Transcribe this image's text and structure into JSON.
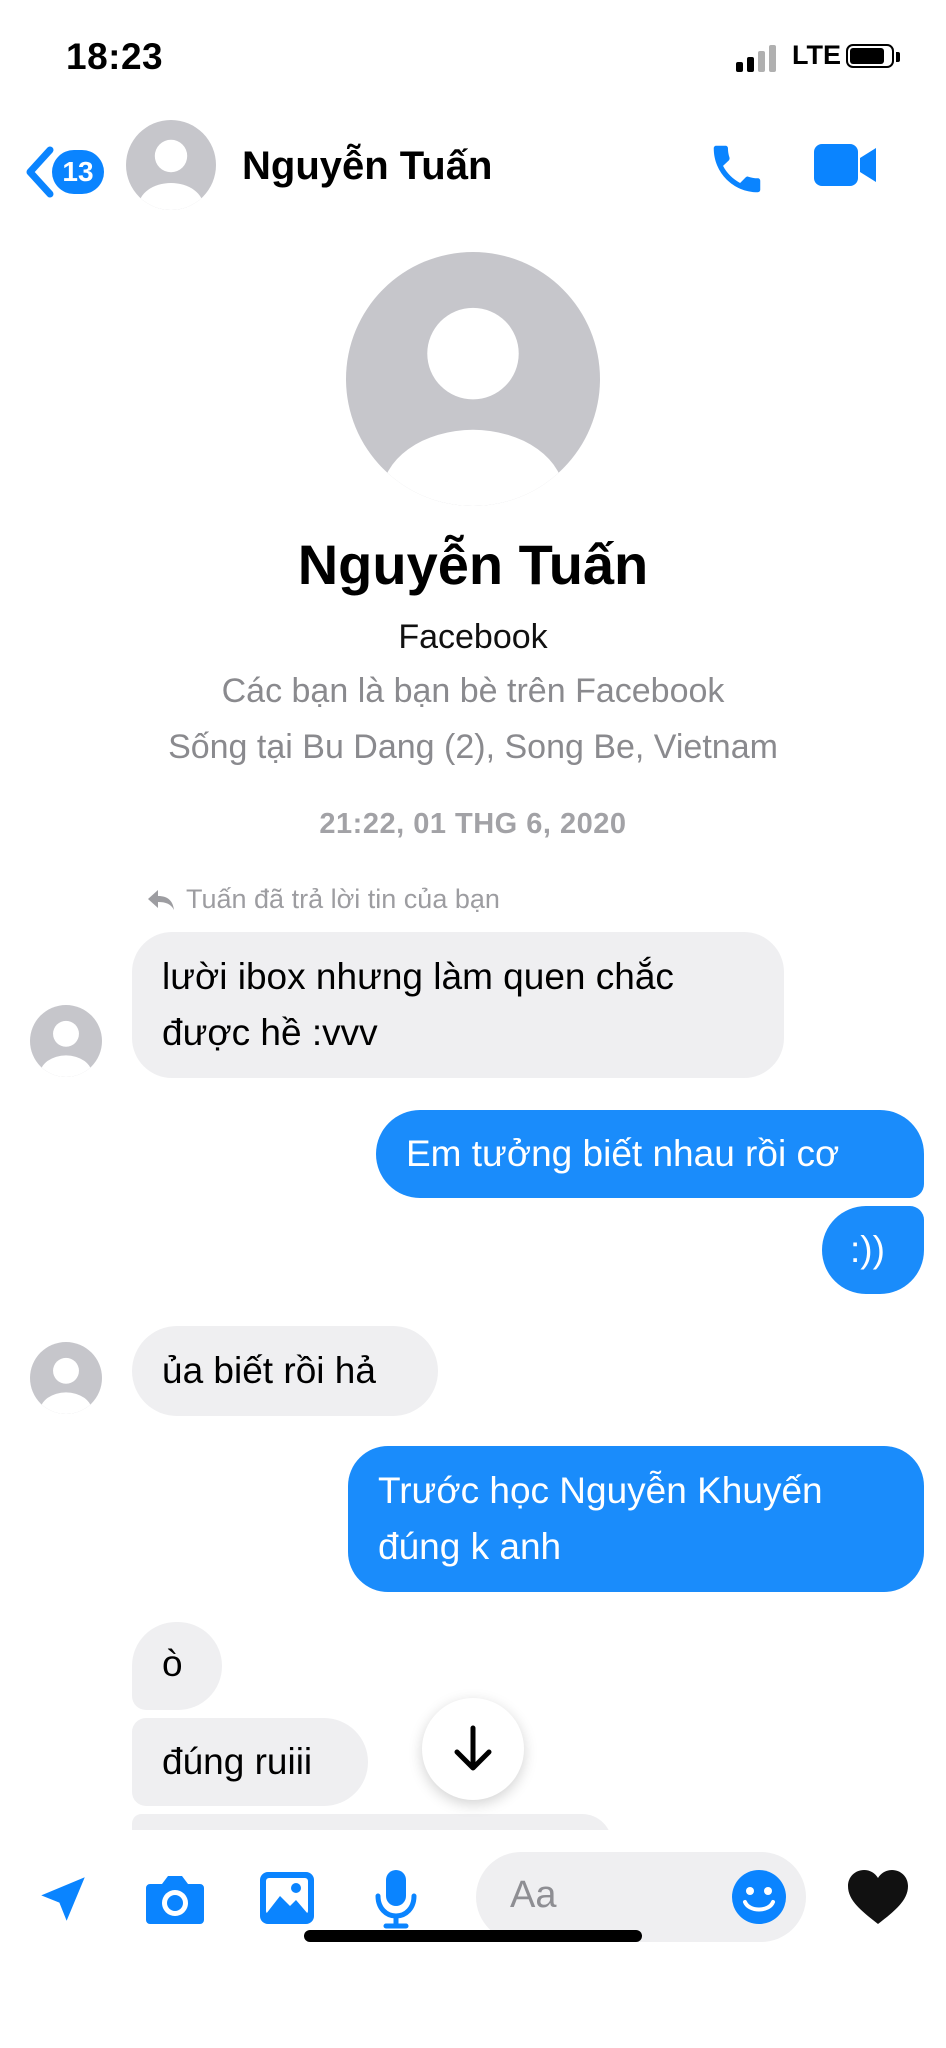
{
  "status_bar": {
    "time": "18:23",
    "network": "LTE"
  },
  "header": {
    "unread_count": "13",
    "contact_name": "Nguyễn Tuấn"
  },
  "profile": {
    "name": "Nguyễn Tuấn",
    "source": "Facebook",
    "relation": "Các bạn là bạn bè trên Facebook",
    "location": "Sống tại Bu Dang (2), Song Be, Vietnam"
  },
  "thread": {
    "timestamp": "21:22, 01 THG 6, 2020",
    "reply_note": "Tuấn đã trả lời tin của bạn",
    "messages": [
      {
        "sender": "them",
        "lines": [
          "lười ibox nhưng làm quen chắc",
          "được hề :vvv"
        ]
      },
      {
        "sender": "me",
        "lines": [
          "Em tưởng biết nhau rồi cơ"
        ]
      },
      {
        "sender": "me",
        "lines": [
          ":))"
        ]
      },
      {
        "sender": "them",
        "lines": [
          "ủa biết rồi hả"
        ]
      },
      {
        "sender": "me",
        "lines": [
          "Trước học Nguyễn Khuyến",
          "đúng k anh"
        ]
      },
      {
        "sender": "them",
        "lines": [
          "ò"
        ]
      },
      {
        "sender": "them",
        "lines": [
          "đúng ruiii"
        ]
      }
    ]
  },
  "composer": {
    "placeholder": "Aa",
    "icons": [
      "location-icon",
      "camera-icon",
      "image-icon",
      "microphone-icon",
      "emoji-icon",
      "heart-icon"
    ]
  },
  "colors": {
    "accent": "#0a84ff",
    "outgoing_bubble": "#1a8cfb",
    "incoming_bubble": "#efeff1"
  }
}
